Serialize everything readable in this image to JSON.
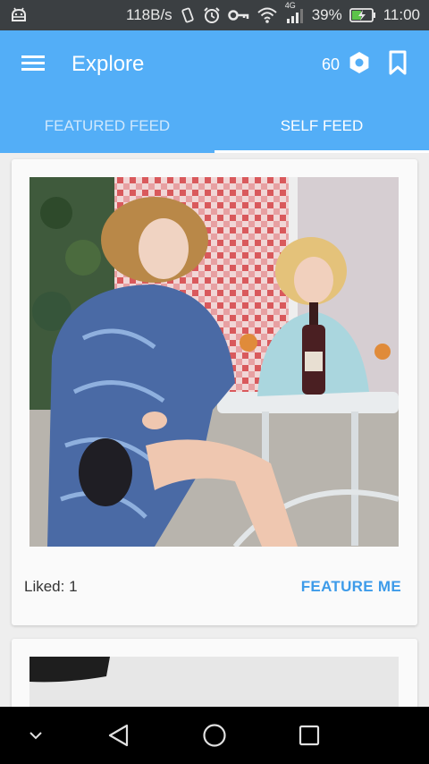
{
  "status_bar": {
    "speed": "118B/s",
    "battery_percent": "39%",
    "time": "11:00",
    "network": "4G",
    "icons": [
      "android-icon",
      "vibrate-icon",
      "alarm-icon",
      "key-icon",
      "wifi-icon",
      "signal-icon",
      "battery-charging-icon"
    ]
  },
  "app_bar": {
    "title": "Explore",
    "coins": "60",
    "menu_icon": "hamburger-menu-icon",
    "coin_icon": "hexagon-coin-icon",
    "bookmark_icon": "bookmark-icon",
    "color": "#53aef7"
  },
  "tabs": [
    {
      "label": "FEATURED FEED",
      "active": false
    },
    {
      "label": "SELF FEED",
      "active": true
    }
  ],
  "feed": {
    "cards": [
      {
        "liked_label": "Liked: 1",
        "action_label": "FEATURE ME"
      }
    ]
  },
  "nav_bar": {
    "icons": [
      "chevron-down-icon",
      "back-triangle-icon",
      "home-circle-icon",
      "recents-square-icon"
    ]
  },
  "colors": {
    "accent": "#3d9be9",
    "status_bar": "#3b3f42"
  }
}
